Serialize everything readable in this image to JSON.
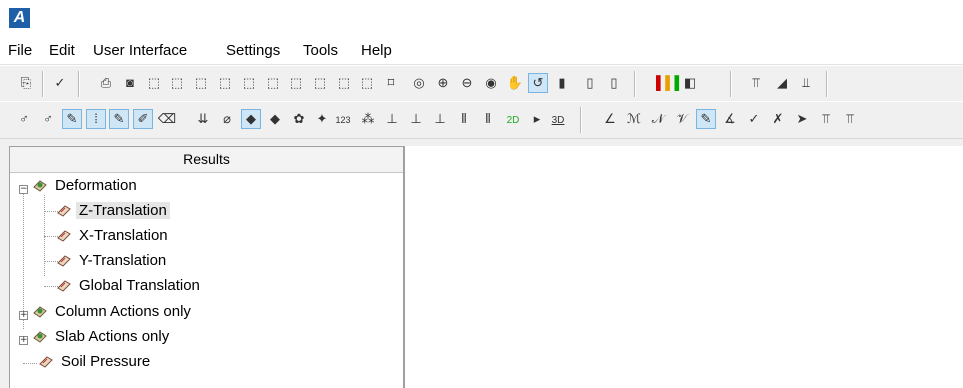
{
  "app": {
    "logo_letter": "A"
  },
  "menu": [
    "File",
    "Edit",
    "User Interface",
    "Settings",
    "Tools",
    "Help"
  ],
  "panel": {
    "title": "Results"
  },
  "tree": {
    "deformation": "Deformation",
    "z_translation": "Z-Translation",
    "x_translation": "X-Translation",
    "y_translation": "Y-Translation",
    "global_translation": "Global Translation",
    "column_actions": "Column Actions only",
    "slab_actions": "Slab Actions only",
    "soil_pressure": "Soil Pressure"
  },
  "toolbar": {
    "threed_label": "3D",
    "twod_label": "2D",
    "num_label": "123"
  },
  "colors": {
    "accent": "#1f5fa8",
    "active_button": "#cfe6f7",
    "selected_row": "#e5e5e5"
  },
  "icons": {
    "folder": "result-folder-icon",
    "leaf": "result-item-icon"
  }
}
